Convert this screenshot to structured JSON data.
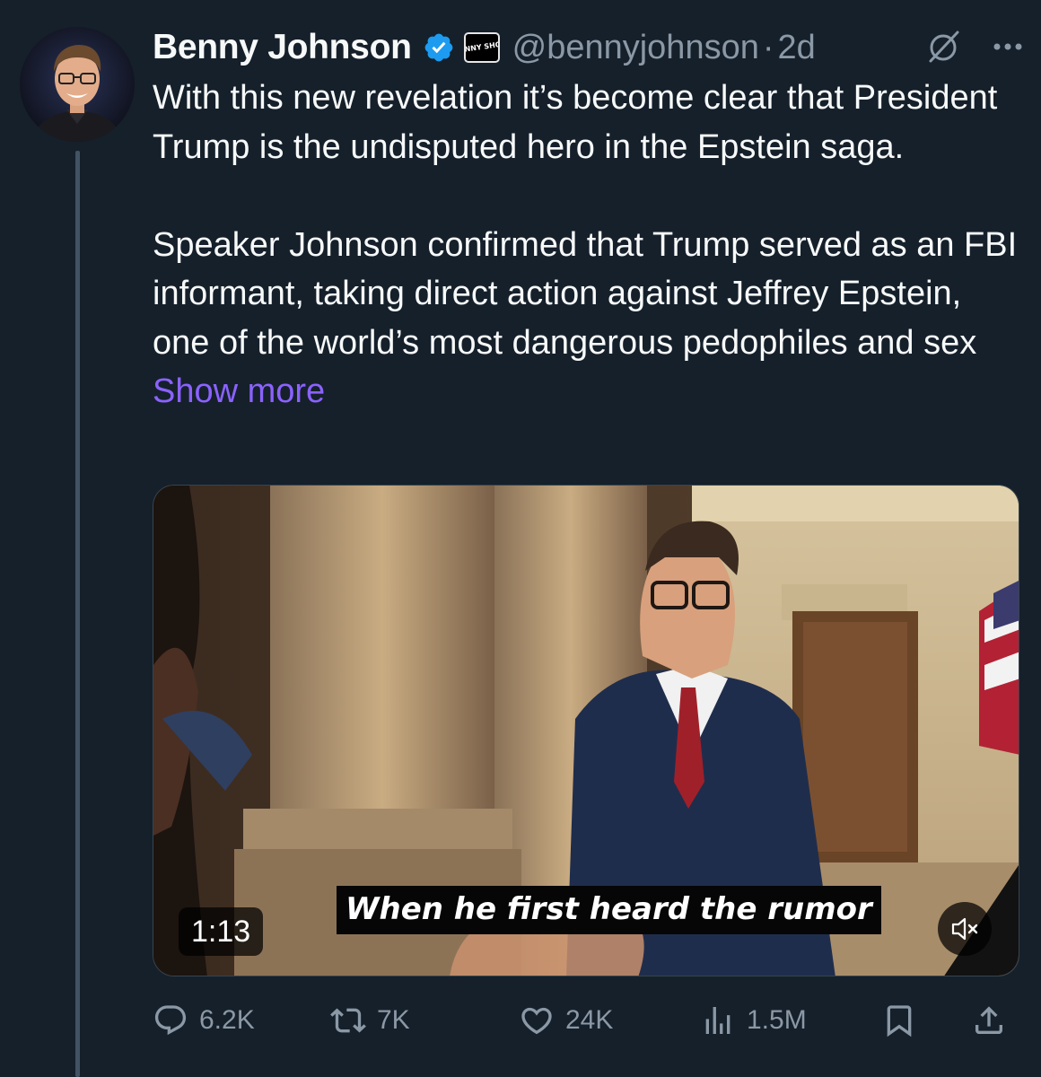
{
  "author": {
    "display_name": "Benny Johnson",
    "handle": "@bennyjohnson",
    "separator": "·",
    "time": "2d",
    "affiliate_badge_text": "BENNY SHOW"
  },
  "tweet": {
    "text": "With this new revelation it’s become clear that President Trump is the undisputed hero in the Epstein saga.\n\nSpeaker Johnson confirmed that Trump served as an FBI informant, taking direct action against Jeffrey Epstein, one of the world’s most dangerous pedophiles and sex ",
    "show_more": "Show more"
  },
  "media": {
    "caption": "When he first heard the rumor",
    "duration": "1:13",
    "mute_icon": "muted-speaker-icon"
  },
  "actions": {
    "replies": "6.2K",
    "reposts": "7K",
    "likes": "24K",
    "views": "1.5M"
  },
  "colors": {
    "background": "#15202b",
    "text": "#f7f9f9",
    "secondary": "#8b98a5",
    "link": "#8b62ff",
    "verified": "#1d9bf0"
  }
}
